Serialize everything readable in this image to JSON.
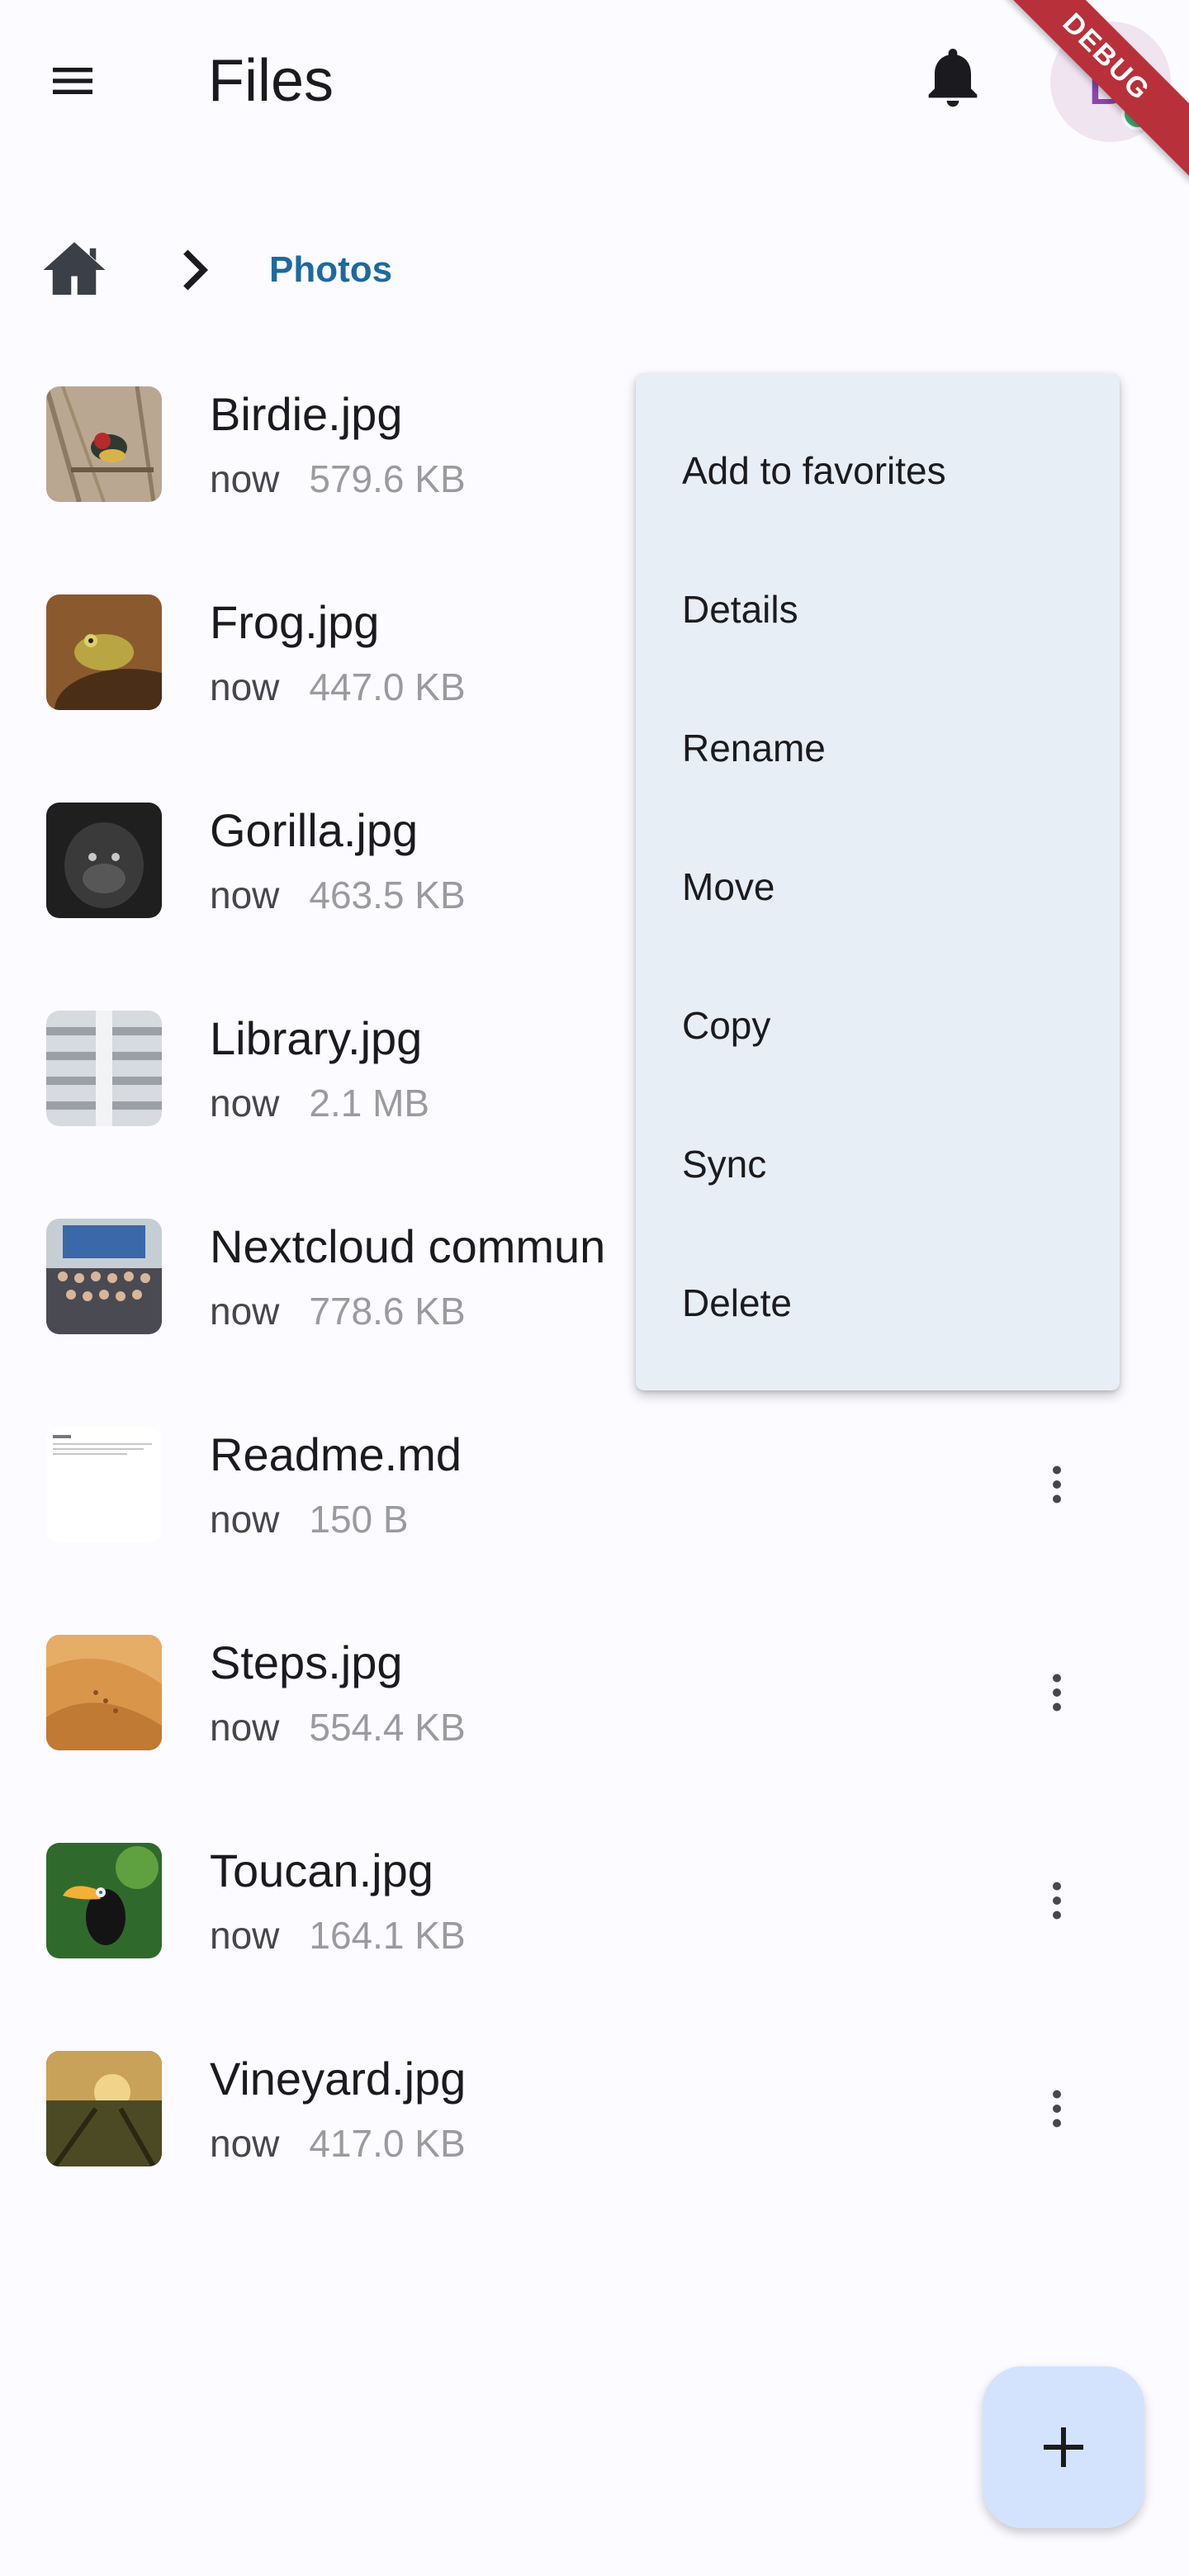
{
  "app_bar": {
    "title": "Files",
    "avatar_initial": "D",
    "debug_banner": "DEBUG",
    "icons": {
      "menu": "menu-icon",
      "notifications": "bell-icon"
    }
  },
  "breadcrumb": {
    "home_icon": "home-icon",
    "separator_icon": "chevron-right-icon",
    "current": "Photos"
  },
  "files": [
    {
      "name": "Birdie.jpg",
      "modified": "now",
      "size": "579.6 KB",
      "thumb": "bird"
    },
    {
      "name": "Frog.jpg",
      "modified": "now",
      "size": "447.0 KB",
      "thumb": "frog"
    },
    {
      "name": "Gorilla.jpg",
      "modified": "now",
      "size": "463.5 KB",
      "thumb": "gorilla"
    },
    {
      "name": "Library.jpg",
      "modified": "now",
      "size": "2.1 MB",
      "thumb": "library"
    },
    {
      "name": "Nextcloud commun",
      "modified": "now",
      "size": "778.6 KB",
      "thumb": "group-photo"
    },
    {
      "name": "Readme.md",
      "modified": "now",
      "size": "150 B",
      "thumb": "document"
    },
    {
      "name": "Steps.jpg",
      "modified": "now",
      "size": "554.4 KB",
      "thumb": "desert"
    },
    {
      "name": "Toucan.jpg",
      "modified": "now",
      "size": "164.1 KB",
      "thumb": "toucan"
    },
    {
      "name": "Vineyard.jpg",
      "modified": "now",
      "size": "417.0 KB",
      "thumb": "vineyard"
    }
  ],
  "context_menu": {
    "items": [
      "Add to favorites",
      "Details",
      "Rename",
      "Move",
      "Copy",
      "Sync",
      "Delete"
    ]
  },
  "fab": {
    "icon": "plus-icon"
  },
  "colors": {
    "background": "#fcfbff",
    "accent": "#1d6aa0",
    "menu_background": "#e8eef6",
    "fab_background": "#d3e3fd",
    "debug_ribbon": "#b8313a",
    "status_online": "#3bb273"
  }
}
